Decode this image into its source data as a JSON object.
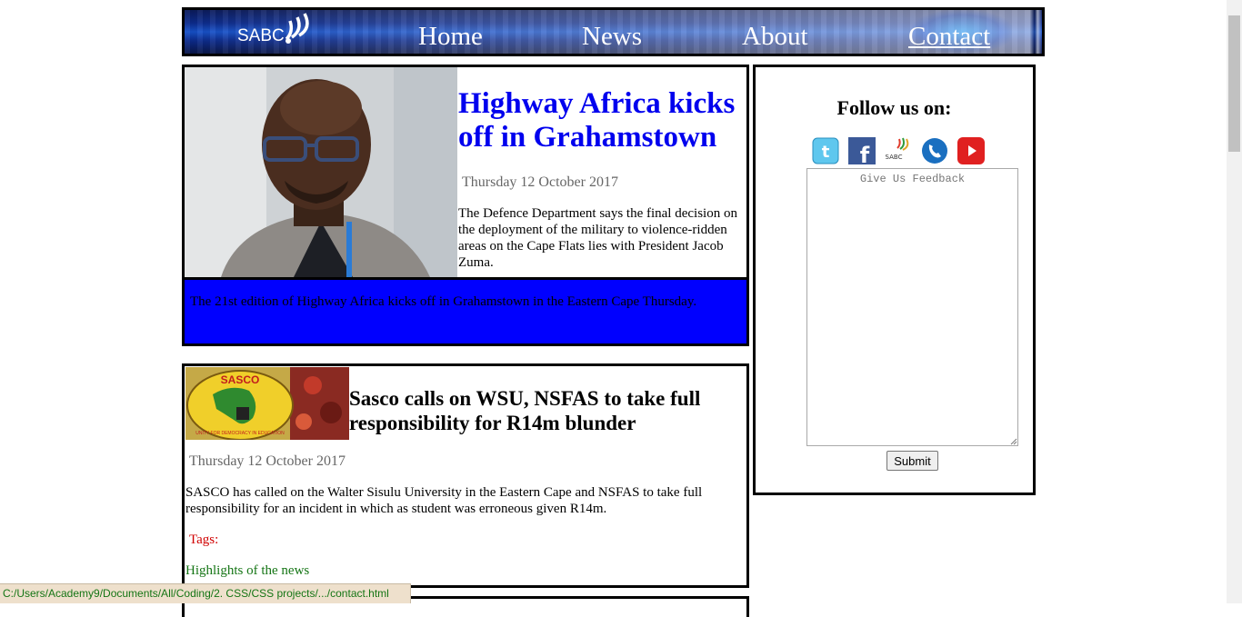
{
  "nav": {
    "logo_text": "SABC",
    "items": [
      {
        "label": "Home"
      },
      {
        "label": "News"
      },
      {
        "label": "About"
      },
      {
        "label": "Contact"
      }
    ]
  },
  "article1": {
    "title": "Highway Africa kicks off in Grahamstown",
    "date": "Thursday 12 October 2017",
    "body": "The Defence Department says the final decision on the deployment of the military to violence-ridden areas on the Cape Flats lies with President Jacob Zuma.",
    "banner": "The 21st edition of Highway Africa kicks off in Grahamstown in the Eastern Cape Thursday."
  },
  "article2": {
    "thumb_text": "SASCO",
    "thumb_motto": "UNITY FOR DEMOCRACY IN EDUCATION",
    "title": "Sasco calls on WSU, NSFAS to take full responsibility for R14m blunder",
    "date": "Thursday 12 October 2017",
    "body": "SASCO has called on the Walter Sisulu University in the Eastern Cape and NSFAS to take full responsibility for an incident in which as student was erroneous given R14m.",
    "tags_label": "Tags:",
    "highlights": "Highlights of the news"
  },
  "sidebar": {
    "follow_title": "Follow us on:",
    "socials": [
      "twitter-icon",
      "facebook-icon",
      "sabc-icon",
      "phone-icon",
      "youtube-icon"
    ],
    "feedback_placeholder": "Give Us Feedback",
    "submit_label": "Submit"
  },
  "statusbar": {
    "url": "C:/Users/Academy9/Documents/All/Coding/2. CSS/CSS projects/.../contact.html"
  },
  "colors": {
    "title_blue": "#0000ee",
    "banner_blue": "#0000ff",
    "tags_red": "#d00000",
    "highlights_green": "#157515"
  }
}
